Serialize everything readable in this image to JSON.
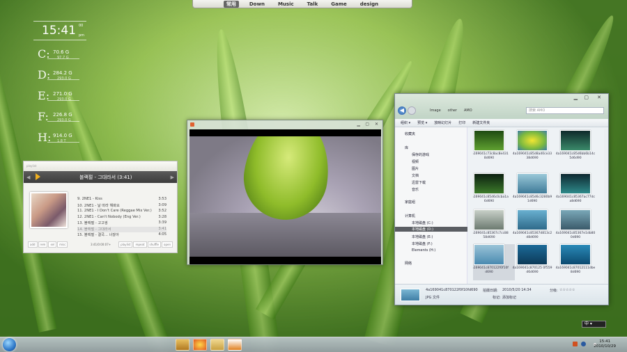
{
  "top_menu": {
    "items": [
      "常用",
      "Down",
      "Music",
      "Talk",
      "Game",
      "design"
    ]
  },
  "clock": {
    "time": "15:41",
    "seconds": "00",
    "ampm": "pm"
  },
  "drives": [
    {
      "letter": "C",
      "used": "70.6 G",
      "total": "97.7 G"
    },
    {
      "letter": "D",
      "used": "284.2 G",
      "total": "293.0 G"
    },
    {
      "letter": "E",
      "used": "271.0 G",
      "total": "293.0 G"
    },
    {
      "letter": "F",
      "used": "226.8 G",
      "total": "293.0 G"
    },
    {
      "letter": "H",
      "used": "914.0 G",
      "total": "1.8 T"
    }
  ],
  "player": {
    "title": "playlist",
    "now_playing": "블랙펄 - 그대라서 (3:41)",
    "tracks": [
      {
        "name": "9. 2NE1 - Kiss",
        "dur": "3:53"
      },
      {
        "name": "10. 2NE1 - 날 따라 해봐요",
        "dur": "3:09"
      },
      {
        "name": "11. 2NE1 - I Don't Care (Reggae Mix Ver.)",
        "dur": "3:52"
      },
      {
        "name": "12. 2NE1 - Can't Nobody (Eng Ver.)",
        "dur": "3:28"
      },
      {
        "name": "13. 블랙펄 - 고고씽",
        "dur": "3:39"
      },
      {
        "name": "14. 블랙펄 - 그대라서",
        "dur": "3:41"
      },
      {
        "name": "15. 블랙펄 - 결국... 너잖아",
        "dur": "4:05"
      }
    ],
    "controls": [
      "add",
      "rem",
      "sel",
      "misc"
    ],
    "timer": "3:41/0:00:07+",
    "modes": [
      "playlist",
      "repeat",
      "shuffle",
      "open"
    ]
  },
  "explorer": {
    "address": [
      "Image",
      "other",
      "AMO"
    ],
    "search_placeholder": "搜索 AMO",
    "toolbar": [
      "组织 ▾",
      "预览 ▾",
      "放映幻灯片",
      "打印",
      "新建文件夹"
    ],
    "nav": {
      "favorites": "收藏夹",
      "library": "库",
      "library_items": [
        "保存的游戏",
        "视频",
        "图片",
        "文档",
        "迅雷下载",
        "音乐"
      ],
      "homegroup": "家庭组",
      "computer": "计算机",
      "computer_items": [
        "本地磁盘 (C:)",
        "本地磁盘 (D:)",
        "本地磁盘 (E:)",
        "本地磁盘 (F:)",
        "Elements (H:)"
      ],
      "network": "网络"
    },
    "files": [
      "4a169041c73c8ac8e4318d690",
      "4a169041c85d8ad0ce3338d690",
      "4a169041c85d6bb6b14c5d6d90",
      "4a169041c85d6c0cba1a6d690",
      "4a169041c85d6c3280b91d690",
      "4a169041c85367ac77dca8d690",
      "4a169041c85367c7cc8858d690",
      "4a169041c85367d813c2d8d690",
      "4a169041c85367e1db800d690",
      "4a169041c870122f0f10fd690",
      "4a169041c870125 0f559d6d690",
      "4a169041c87012111dbe8d690"
    ],
    "details": {
      "filename": "4a169041c870122f0f10fd690",
      "type": "JPG 文件",
      "date_label": "拍摄日期:",
      "date_value": "2010/5/20 14:34",
      "tags_label": "标记:",
      "tags_value": "添加标记",
      "rating_label": "分级:",
      "rating_value": "☆☆☆☆☆"
    }
  },
  "language_bar": "中 ▾",
  "taskbar": {
    "time": "15:41",
    "date": "2010/10/29"
  }
}
